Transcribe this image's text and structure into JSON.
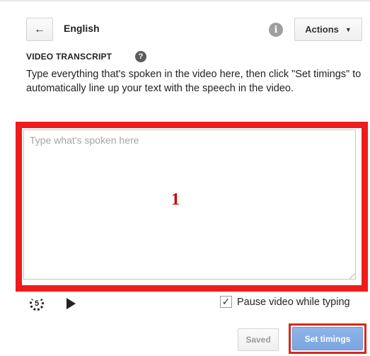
{
  "header": {
    "back_icon": "arrow-left-icon",
    "back_glyph": "←",
    "language": "English",
    "info_icon": "info-icon",
    "info_glyph": "i",
    "actions_label": "Actions",
    "actions_caret": "▼"
  },
  "transcript": {
    "title": "VIDEO TRANSCRIPT",
    "help_glyph": "?",
    "instructions": "Type everything that's spoken in the video here, then click \"Set timings\" to automatically line up your text with the speech in the video.",
    "placeholder": "Type what's spoken here",
    "value": ""
  },
  "annotation": {
    "callout_number": "1",
    "highlight_color": "#ee1c1c"
  },
  "controls": {
    "replay_icon": "replay-5-seconds-icon",
    "replay_seconds": "5",
    "play_icon": "play-icon",
    "pause_while_typing_checked": true,
    "pause_while_typing_label": "Pause video while typing"
  },
  "footer": {
    "saved_label": "Saved",
    "set_timings_label": "Set timings",
    "accent_color": "#7aa5e0"
  }
}
